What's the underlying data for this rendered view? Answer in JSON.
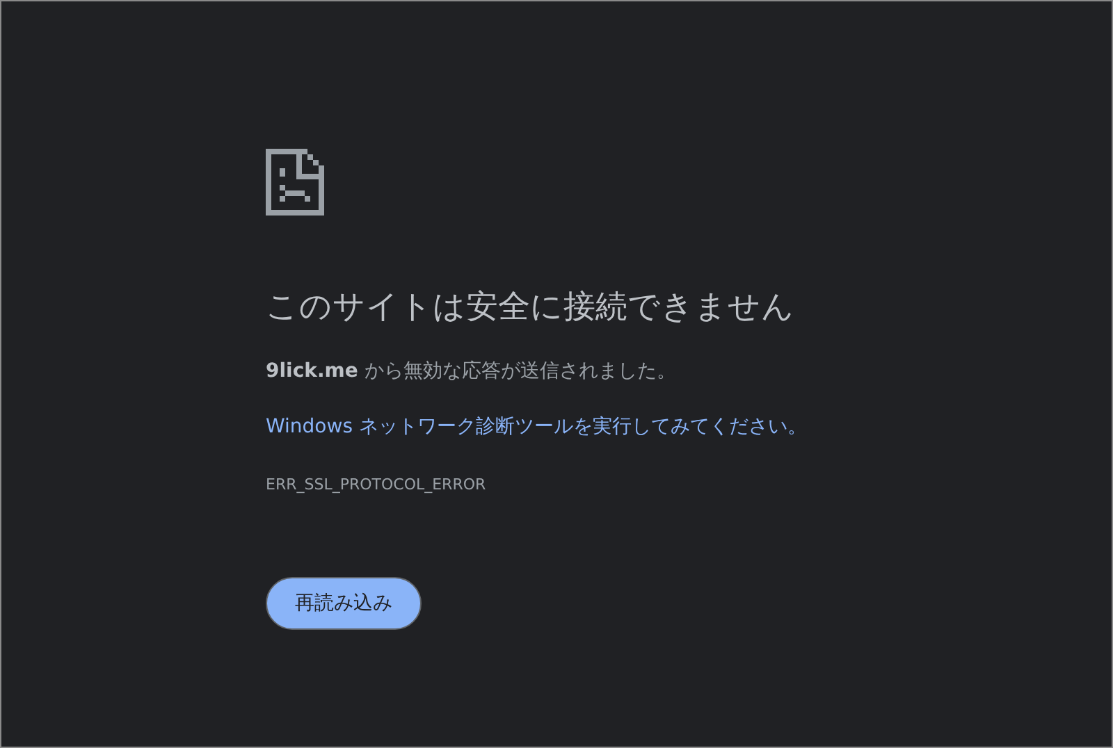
{
  "heading": "このサイトは安全に接続できません",
  "summary": "**9lick.me** から無効な応答が送信されました。",
  "suggestion_link": "Windows ネットワーク診断ツールを実行してみてください。",
  "error_code": "ERR_SSL_PROTOCOL_ERROR",
  "reload_button": "再読み込み"
}
